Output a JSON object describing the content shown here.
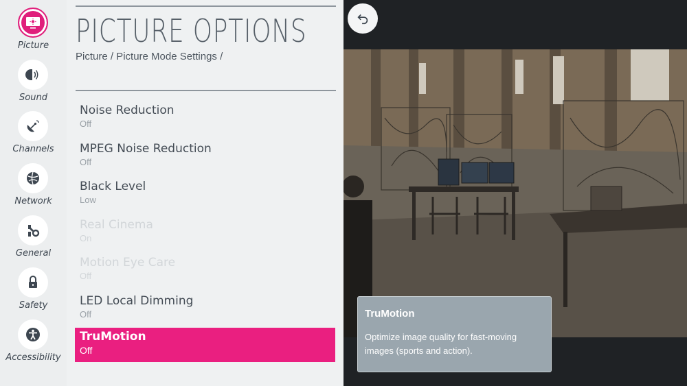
{
  "sidebar": {
    "items": [
      {
        "label": "Picture",
        "icon": "picture-icon",
        "active": true
      },
      {
        "label": "Sound",
        "icon": "sound-icon"
      },
      {
        "label": "Channels",
        "icon": "channels-icon"
      },
      {
        "label": "Network",
        "icon": "network-icon"
      },
      {
        "label": "General",
        "icon": "general-icon"
      },
      {
        "label": "Safety",
        "icon": "lock-icon"
      },
      {
        "label": "Accessibility",
        "icon": "accessibility-icon"
      }
    ]
  },
  "menu": {
    "title": "PICTURE OPTIONS",
    "breadcrumb": "Picture / Picture Mode Settings /",
    "items": [
      {
        "name": "Noise Reduction",
        "value": "Off"
      },
      {
        "name": "MPEG Noise Reduction",
        "value": "Off"
      },
      {
        "name": "Black Level",
        "value": "Low"
      },
      {
        "name": "Real Cinema",
        "value": "On",
        "disabled": true
      },
      {
        "name": "Motion Eye Care",
        "value": "Off",
        "disabled": true
      },
      {
        "name": "LED Local Dimming",
        "value": "Off"
      },
      {
        "name": "TruMotion",
        "value": "Off",
        "selected": true
      }
    ]
  },
  "tooltip": {
    "title": "TruMotion",
    "body": "Optimize image quality for fast-moving images (sports and action)."
  },
  "colors": {
    "accent": "#ea1f80",
    "tooltip_bg": "#9aa6ae"
  }
}
